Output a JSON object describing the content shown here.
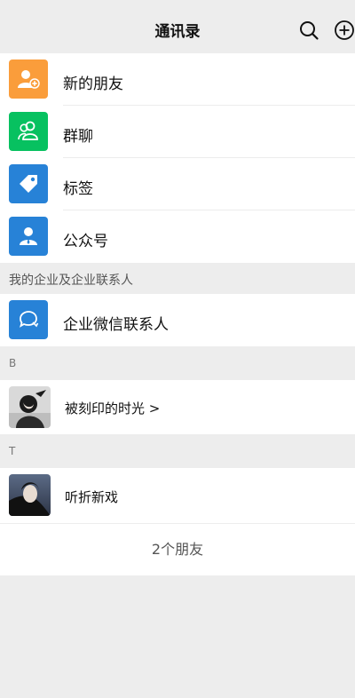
{
  "header": {
    "title": "通讯录",
    "icons": [
      "search-icon",
      "add-circle-icon"
    ]
  },
  "functions": [
    {
      "label": "新的朋友",
      "icon": "new-friend-icon",
      "color": "#fa9d3b"
    },
    {
      "label": "群聊",
      "icon": "group-chat-icon",
      "color": "#07c160"
    },
    {
      "label": "标签",
      "icon": "tag-icon",
      "color": "#2782d7"
    },
    {
      "label": "公众号",
      "icon": "official-account-icon",
      "color": "#2782d7"
    }
  ],
  "enterprise": {
    "section_title": "我的企业及企业联系人",
    "item_label": "企业微信联系人",
    "icon": "wecom-contacts-icon",
    "color": "#2782d7"
  },
  "groups": [
    {
      "letter": "B",
      "contacts": [
        {
          "name": "被刻印的时光 >",
          "avatar": "avatar-girl-dark"
        }
      ]
    },
    {
      "letter": "T",
      "contacts": [
        {
          "name": "听折新戏",
          "avatar": "avatar-girl-sky"
        }
      ]
    }
  ],
  "footer": {
    "count_text": "2个朋友"
  }
}
